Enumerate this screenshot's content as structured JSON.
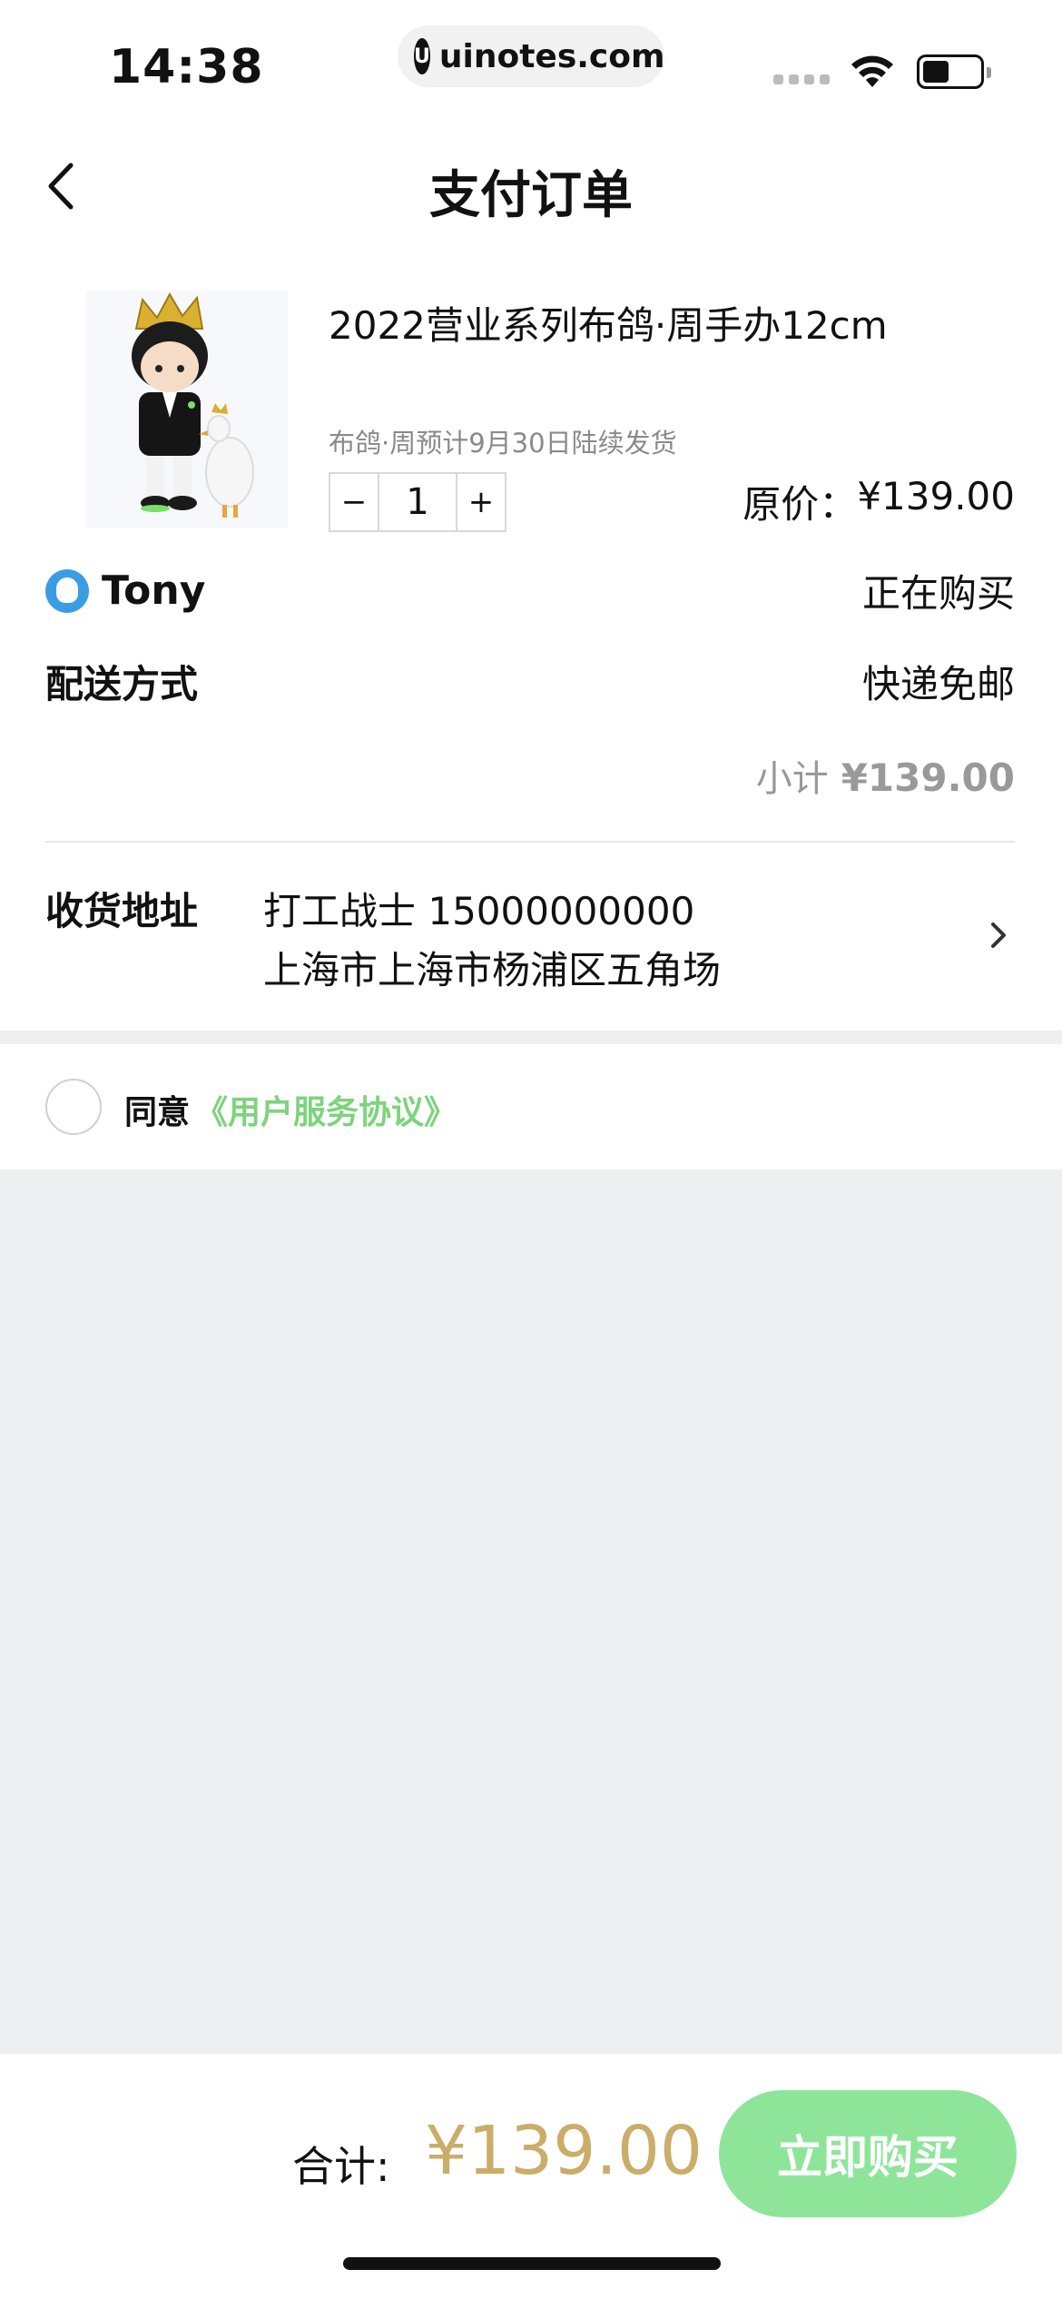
{
  "status_bar": {
    "time": "14:38",
    "url": "uinotes.com",
    "url_logo": "U"
  },
  "nav": {
    "title": "支付订单"
  },
  "product": {
    "title": "2022营业系列布鸽·周手办12cm",
    "subtitle": "布鸽·周预计9月30日陆续发货",
    "quantity": "1",
    "decrement_label": "−",
    "increment_label": "+",
    "original_price_label": "原价：",
    "original_price": "¥139.00"
  },
  "buyer": {
    "name": "Tony",
    "status": "正在购买"
  },
  "shipping": {
    "label": "配送方式",
    "value": "快递免邮"
  },
  "subtotal": {
    "label": "小计",
    "value": "¥139.00"
  },
  "address": {
    "label": "收货地址",
    "line1": "打工战士 15000000000",
    "line2": "上海市上海市杨浦区五角场"
  },
  "agreement": {
    "prefix": "同意",
    "link": "《用户服务协议》",
    "checked": false
  },
  "footer": {
    "total_label": "合计:",
    "total_value": "¥139.00",
    "buy_label": "立即购买"
  },
  "colors": {
    "accent_green": "#8ee59a",
    "link_green": "#7cd47c",
    "price_gold": "#c9ad69",
    "background_gray": "#eeeff1"
  },
  "icons": {
    "back": "chevron-left-icon",
    "address_arrow": "chevron-right-icon",
    "buyer_avatar": "qq-penguin-icon",
    "wifi": "wifi-icon",
    "battery": "battery-icon"
  }
}
